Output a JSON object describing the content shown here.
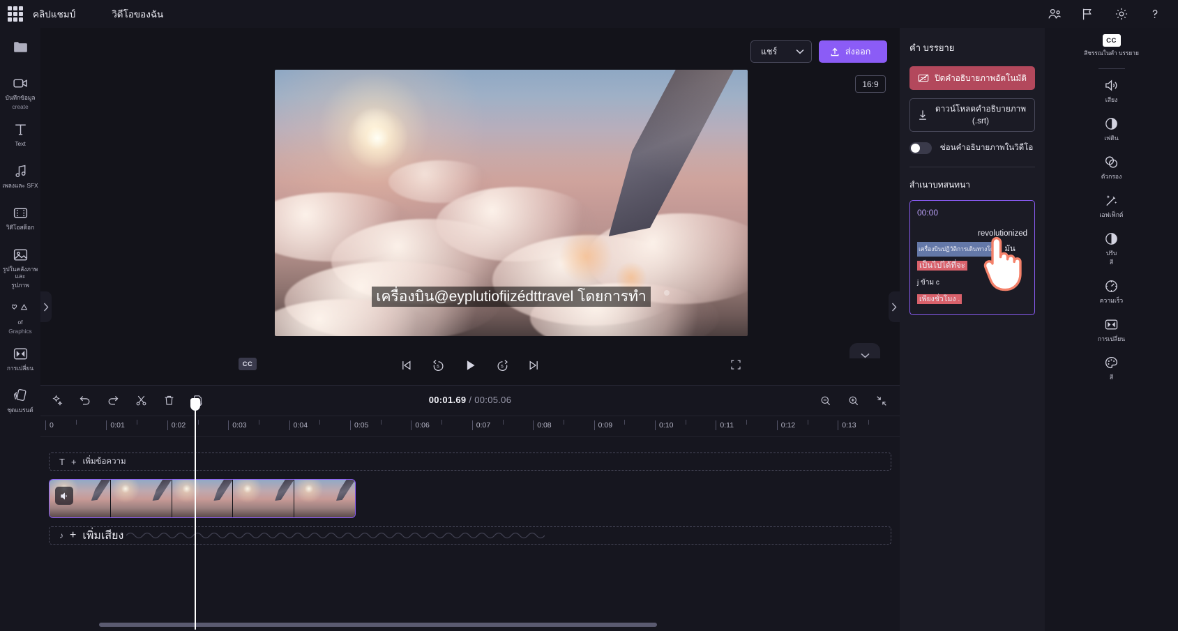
{
  "topbar": {
    "waffle_name": "app-launcher",
    "brand": "คลิปแชมป์",
    "doc_name": "วิดีโอของฉัน",
    "icons": [
      {
        "name": "collab-icon",
        "glyph": "people"
      },
      {
        "name": "flag-icon",
        "glyph": "flag"
      },
      {
        "name": "settings-icon",
        "glyph": "gear"
      },
      {
        "name": "help-icon",
        "glyph": "question"
      }
    ]
  },
  "left_rail": {
    "items": [
      {
        "id": "media",
        "label": "",
        "icon": "folder-icon"
      },
      {
        "id": "record-create",
        "label_line1": "บันทึกข้อมูล",
        "label_line2": "create",
        "icon": "camera-icon"
      },
      {
        "id": "text",
        "label_line1": "Text",
        "label_line2": "",
        "icon": "text-icon"
      },
      {
        "id": "music-sfx",
        "label_line1": "เพลงและ SFX",
        "label_line2": "",
        "icon": "music-icon"
      },
      {
        "id": "stock-video",
        "label_line1": "วิดีโอสต็อก",
        "label_line2": "",
        "icon": "film-icon"
      },
      {
        "id": "stock-image",
        "label_line1": "รูปในคลังภาพและ",
        "label_line2": "รูปภาพ",
        "icon": "image-icon"
      },
      {
        "id": "graphics",
        "label_line1": "of",
        "label_line2": "Graphics",
        "icon": "shapes-icon"
      },
      {
        "id": "transitions",
        "label_line1": "การเปลี่ยน",
        "label_line2": "",
        "icon": "transition-icon"
      },
      {
        "id": "brand-kit",
        "label_line1": "ชุดแบรนด์",
        "label_line2": "",
        "icon": "brandkit-icon"
      }
    ]
  },
  "stage": {
    "share_label": "แชร์",
    "export_label": "ส่งออก",
    "aspect_ratio": "16:9",
    "caption_text": "เครื่องบิน@eyplutiofiizédttravel โดยการทำ",
    "cc_badge": "CC"
  },
  "transport": {
    "cc_label": "CC",
    "buttons": [
      {
        "name": "skip-start-button"
      },
      {
        "name": "rewind-5-button",
        "label": "5"
      },
      {
        "name": "play-button"
      },
      {
        "name": "forward-5-button",
        "label": "5"
      },
      {
        "name": "skip-end-button"
      }
    ],
    "fullscreen_name": "fullscreen-button"
  },
  "timeline": {
    "tools": [
      {
        "name": "magic-tool-button"
      },
      {
        "name": "undo-button"
      },
      {
        "name": "redo-button"
      },
      {
        "name": "split-button"
      },
      {
        "name": "delete-button"
      },
      {
        "name": "duplicate-button"
      }
    ],
    "current_time": "00:01.69",
    "separator": "/",
    "total_time": "00:05.06",
    "zoom_tools": [
      {
        "name": "zoom-out-button"
      },
      {
        "name": "zoom-in-button"
      },
      {
        "name": "fit-timeline-button"
      }
    ],
    "ruler_ticks": [
      "0",
      "0:01",
      "0:02",
      "0:03",
      "0:04",
      "0:05",
      "0:06",
      "0:07",
      "0:08",
      "0:09",
      "0:10",
      "0:11",
      "0:12",
      "0:13"
    ],
    "add_text_label": "เพิ่มข้อความ",
    "add_text_plus": "+",
    "add_audio_label": "เพิ่มเสียง",
    "add_audio_plus": "+",
    "text_track_icon": "T"
  },
  "panel": {
    "title": "คำ บรรยาย",
    "disable_autocaption_label": "ปิดคำอธิบายภาพอัตโนมัติ",
    "disable_autocaption_icon": "captions-off-icon",
    "download_label_line1": "ดาวน์โหลดคำอธิบายภาพ",
    "download_label_line2": "(.srt)",
    "download_icon": "download-icon",
    "hide_captions_label": "ซ่อนคำอธิบายภาพในวิดีโอ",
    "transcript_section_title": "สำเนาบทสนทนา",
    "transcript": {
      "time": "00:00",
      "line_right": "revolutionized",
      "line_highlight_blue": "เครื่องบินปฏิวัติการเดินทางโดย",
      "line_tail": "มัน",
      "line_highlight_red": "เป็นไปได้ที่จะ",
      "line_small": "j ข้าม c",
      "line_last": "เพียงชั่วโมง ."
    },
    "cursor_name": "hand-cursor"
  },
  "right_rail": {
    "cc_badge": "CC",
    "cc_label": "สีชรรณในคำ บรรยาย",
    "items": [
      {
        "id": "audio",
        "label": "เสียง",
        "icon": "speaker-icon"
      },
      {
        "id": "fade",
        "label": "เฟดิน",
        "icon": "fade-icon"
      },
      {
        "id": "filters",
        "label": "ตัวกรอง",
        "icon": "filters-icon"
      },
      {
        "id": "effects",
        "label": "เอฟเฟ็กต์",
        "icon": "magic-wand-icon"
      },
      {
        "id": "adjust-color",
        "label_line1": "ปรับ",
        "label_line2": "สี",
        "icon": "contrast-icon"
      },
      {
        "id": "speed",
        "label": "ความเร็ว",
        "icon": "speedometer-icon"
      },
      {
        "id": "transitions",
        "label": "การเปลี่ยน",
        "icon": "transition-icon"
      },
      {
        "id": "color",
        "label": "สี",
        "icon": "palette-icon"
      }
    ]
  },
  "colors": {
    "accent_purple": "#8b5cf6",
    "danger_red": "#b3485c",
    "panel_bg": "#1b1b25",
    "app_bg": "#13131a",
    "rail_bg": "#16161f",
    "highlight_blue": "#6478a8",
    "highlight_red": "#d9616b"
  }
}
